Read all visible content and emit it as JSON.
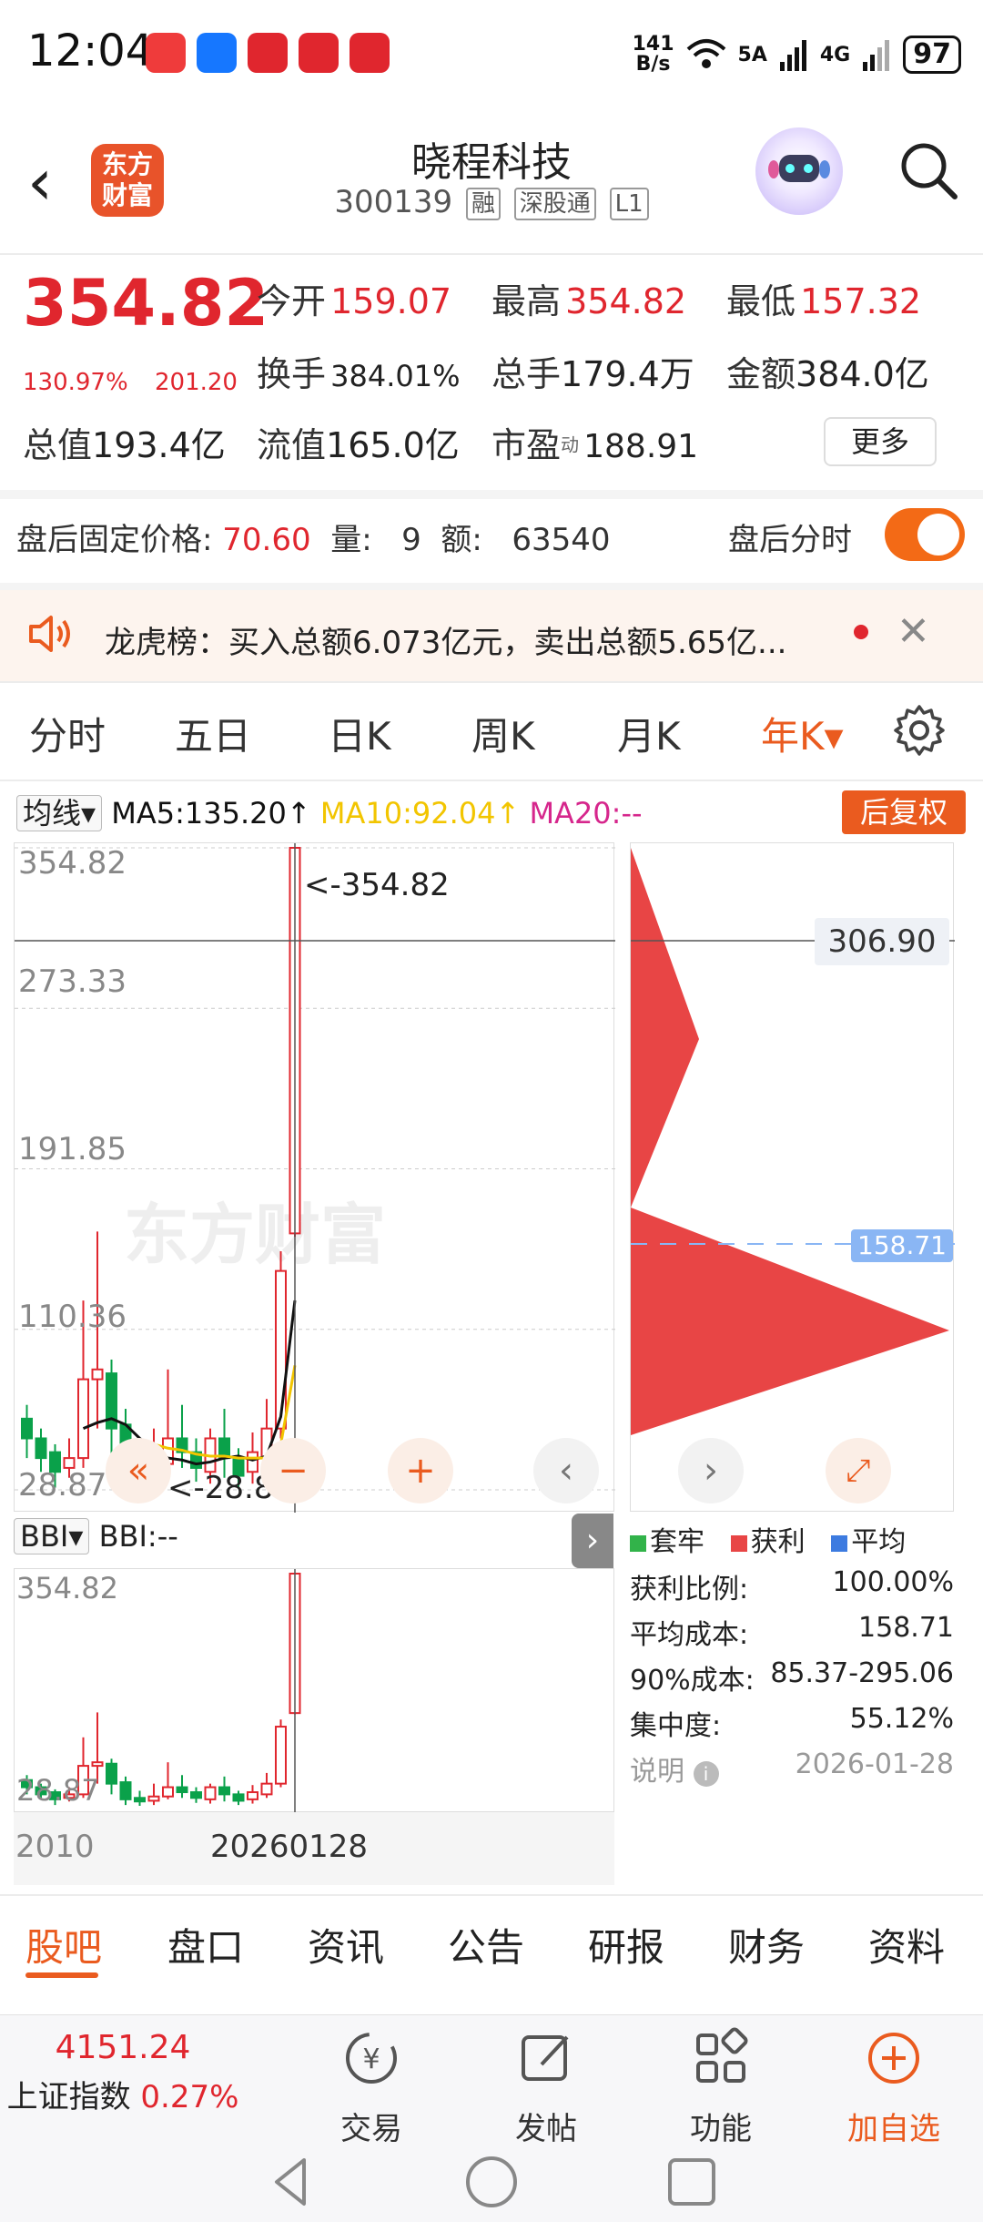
{
  "status_bar": {
    "time": "12:04",
    "net_speed_top": "141",
    "net_speed_bottom": "B/s",
    "battery": "97",
    "signal1": "5A",
    "signal2": "4G"
  },
  "header": {
    "logo_line1": "东方",
    "logo_line2": "财富",
    "stock_name": "晓程科技",
    "stock_code": "300139",
    "tags": [
      "融",
      "深股通",
      "L1"
    ]
  },
  "quote": {
    "price": "354.82",
    "change_pct": "130.97%",
    "change": "201.20",
    "open_label": "今开",
    "open": "159.07",
    "high_label": "最高",
    "high": "354.82",
    "low_label": "最低",
    "low": "157.32",
    "turnover_label": "换手",
    "turnover": "384.01%",
    "volume_label": "总手",
    "volume": "179.4万",
    "amount_label": "金额",
    "amount": "384.0亿",
    "mktcap_label": "总值",
    "mktcap": "193.4亿",
    "float_label": "流值",
    "float": "165.0亿",
    "pe_label": "市盈",
    "pe_sup": "动",
    "pe": "188.91",
    "more": "更多"
  },
  "after_hours": {
    "price_label": "盘后固定价格:",
    "price": "70.60",
    "vol_label": "量:",
    "vol": "9",
    "amt_label": "额:",
    "amt": "63540",
    "toggle_label": "盘后分时",
    "toggle_on": true
  },
  "notice": {
    "text": "龙虎榜：买入总额6.073亿元，卖出总额5.65亿..."
  },
  "period_tabs": [
    "分时",
    "五日",
    "日K",
    "周K",
    "月K",
    "年K▾"
  ],
  "active_period": 5,
  "ma": {
    "selector": "均线▾",
    "ma5": "MA5:135.20↑",
    "ma10": "MA10:92.04↑",
    "ma20": "MA20:--",
    "fuquan": "后复权",
    "colors": {
      "ma5": "#111111",
      "ma10": "#f2c500",
      "ma20": "#d6268c"
    }
  },
  "kline": {
    "y_labels": [
      "354.82",
      "273.33",
      "191.85",
      "110.36",
      "28.87"
    ],
    "max_marker": "<-354.82",
    "min_marker": "<-28.87",
    "crosshair_price": "306.90",
    "watermark": "东方财富"
  },
  "bbi": {
    "selector": "BBI▾",
    "value": "BBI:--",
    "y_top": "354.82",
    "y_bottom": "28.87"
  },
  "dates": {
    "start": "2010",
    "cursor": "20260128"
  },
  "chip": {
    "avg_cost_tag": "158.71",
    "legend": [
      "套牢",
      "获利",
      "平均"
    ],
    "legend_colors": [
      "#32b34a",
      "#e84545",
      "#3d7be0"
    ],
    "rows": [
      {
        "label": "获利比例:",
        "value": "100.00%"
      },
      {
        "label": "平均成本:",
        "value": "158.71"
      },
      {
        "label": "90%成本:",
        "value": "85.37-295.06"
      },
      {
        "label": "集中度:",
        "value": "55.12%"
      },
      {
        "label": "说明",
        "value": "2026-01-28"
      }
    ]
  },
  "bottom_tabs": [
    "股吧",
    "盘口",
    "资讯",
    "公告",
    "研报",
    "财务",
    "资料"
  ],
  "footer": {
    "index_value": "4151.24",
    "index_name": "上证指数",
    "index_change": "0.27%",
    "trade": "交易",
    "post": "发帖",
    "function": "功能",
    "add_watch": "加自选"
  },
  "chart_data": {
    "type": "candlestick",
    "title": "",
    "ylim": [
      28.87,
      354.82
    ],
    "y_ticks": [
      354.82,
      273.33,
      191.85,
      110.36,
      28.87
    ],
    "candles": [
      {
        "o": 65,
        "c": 55,
        "h": 72,
        "l": 45
      },
      {
        "o": 55,
        "c": 45,
        "h": 60,
        "l": 38
      },
      {
        "o": 48,
        "c": 38,
        "h": 52,
        "l": 30
      },
      {
        "o": 40,
        "c": 45,
        "h": 55,
        "l": 35
      },
      {
        "o": 45,
        "c": 85,
        "h": 125,
        "l": 40
      },
      {
        "o": 85,
        "c": 90,
        "h": 160,
        "l": 60
      },
      {
        "o": 88,
        "c": 60,
        "h": 95,
        "l": 45
      },
      {
        "o": 62,
        "c": 38,
        "h": 70,
        "l": 30
      },
      {
        "o": 40,
        "c": 35,
        "h": 50,
        "l": 28.87
      },
      {
        "o": 36,
        "c": 42,
        "h": 60,
        "l": 30
      },
      {
        "o": 42,
        "c": 55,
        "h": 90,
        "l": 38
      },
      {
        "o": 55,
        "c": 48,
        "h": 72,
        "l": 40
      },
      {
        "o": 48,
        "c": 40,
        "h": 55,
        "l": 33
      },
      {
        "o": 38,
        "c": 55,
        "h": 60,
        "l": 32
      },
      {
        "o": 55,
        "c": 45,
        "h": 70,
        "l": 35
      },
      {
        "o": 45,
        "c": 36,
        "h": 50,
        "l": 30
      },
      {
        "o": 38,
        "c": 48,
        "h": 58,
        "l": 32
      },
      {
        "o": 45,
        "c": 60,
        "h": 75,
        "l": 40
      },
      {
        "o": 60,
        "c": 140,
        "h": 150,
        "l": 55
      },
      {
        "o": 159.07,
        "c": 354.82,
        "h": 354.82,
        "l": 157.32
      }
    ],
    "ma5": [
      null,
      null,
      null,
      null,
      60,
      63,
      65,
      62,
      55,
      50,
      45,
      44,
      42,
      43,
      45,
      46,
      44,
      46,
      66,
      125
    ],
    "ma10": [
      null,
      null,
      null,
      null,
      null,
      null,
      null,
      null,
      null,
      52,
      50,
      49,
      47,
      46,
      46,
      45,
      45,
      45,
      52,
      92.04
    ]
  }
}
